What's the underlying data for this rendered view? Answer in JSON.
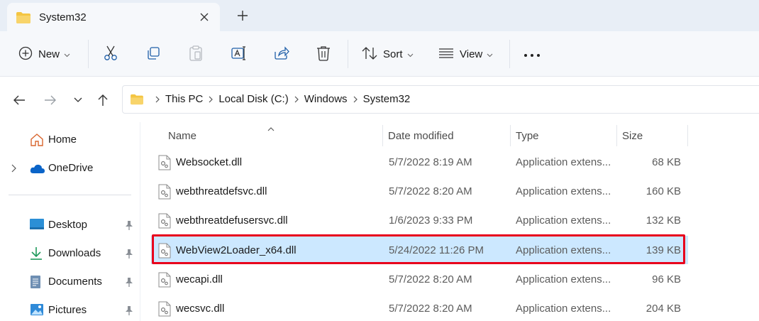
{
  "window": {
    "tab_title": "System32",
    "tab_icon": "folder-icon",
    "close_icon": "close-icon",
    "new_tab_icon": "plus-icon"
  },
  "toolbar": {
    "new_label": "New",
    "sort_label": "Sort",
    "view_label": "View",
    "icons": [
      "cut-icon",
      "copy-icon",
      "paste-icon",
      "rename-icon",
      "share-icon",
      "delete-icon",
      "more-icon"
    ]
  },
  "nav": {
    "breadcrumbs": [
      "This PC",
      "Local Disk (C:)",
      "Windows",
      "System32"
    ]
  },
  "sidebar": {
    "items": [
      {
        "label": "Home",
        "icon": "home-icon"
      },
      {
        "label": "OneDrive",
        "icon": "cloud-icon"
      },
      {
        "label": "Desktop",
        "icon": "desktop-icon"
      },
      {
        "label": "Downloads",
        "icon": "download-icon"
      },
      {
        "label": "Documents",
        "icon": "document-icon"
      },
      {
        "label": "Pictures",
        "icon": "pictures-icon"
      }
    ]
  },
  "columns": {
    "name": "Name",
    "date": "Date modified",
    "type": "Type",
    "size": "Size"
  },
  "files": [
    {
      "name": "Websocket.dll",
      "date": "5/7/2022 8:19 AM",
      "type": "Application extens...",
      "size": "68 KB"
    },
    {
      "name": "webthreatdefsvc.dll",
      "date": "5/7/2022 8:20 AM",
      "type": "Application extens...",
      "size": "160 KB"
    },
    {
      "name": "webthreatdefusersvc.dll",
      "date": "1/6/2023 9:33 PM",
      "type": "Application extens...",
      "size": "132 KB"
    },
    {
      "name": "WebView2Loader_x64.dll",
      "date": "5/24/2022 11:26 PM",
      "type": "Application extens...",
      "size": "139 KB"
    },
    {
      "name": "wecapi.dll",
      "date": "5/7/2022 8:20 AM",
      "type": "Application extens...",
      "size": "96 KB"
    },
    {
      "name": "wecsvc.dll",
      "date": "5/7/2022 8:20 AM",
      "type": "Application extens...",
      "size": "204 KB"
    }
  ],
  "colors": {
    "selected_row": "#cce8ff",
    "highlight_border": "#e8001c",
    "folder_yellow": "#f4c542",
    "accent_blue": "#0a64c8"
  }
}
